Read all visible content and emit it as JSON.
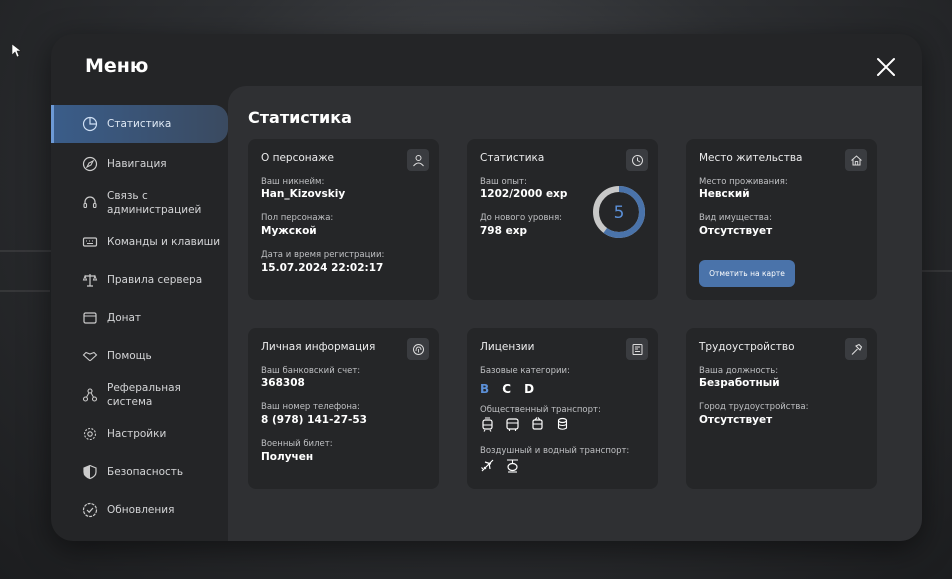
{
  "menu": {
    "title": "Меню"
  },
  "sidebar": {
    "items": [
      {
        "label": "Статистика",
        "icon": "pie-chart-icon"
      },
      {
        "label": "Навигация",
        "icon": "compass-icon"
      },
      {
        "label": "Связь с администрацией",
        "icon": "headset-icon"
      },
      {
        "label": "Команды и клавиши",
        "icon": "keyboard-icon"
      },
      {
        "label": "Правила сервера",
        "icon": "scales-icon"
      },
      {
        "label": "Донат",
        "icon": "wallet-icon"
      },
      {
        "label": "Помощь",
        "icon": "handshake-icon"
      },
      {
        "label": "Реферальная система",
        "icon": "referral-icon"
      },
      {
        "label": "Настройки",
        "icon": "gear-icon"
      },
      {
        "label": "Безопасность",
        "icon": "shield-icon"
      },
      {
        "label": "Обновления",
        "icon": "check-badge-icon"
      }
    ]
  },
  "page": {
    "title": "Статистика"
  },
  "character": {
    "title": "О персонаже",
    "nickname_label": "Ваш никнейм:",
    "nickname": "Han_Kizovskiy",
    "gender_label": "Пол персонажа:",
    "gender": "Мужской",
    "reg_label": "Дата и время регистрации:",
    "reg_date": "15.07.2024 22:02:17"
  },
  "stats": {
    "title": "Статистика",
    "exp_label": "Ваш опыт:",
    "exp": "1202/2000 exp",
    "next_label": "До нового уровня:",
    "next": "798 exp",
    "level": "5",
    "progress": 0.601
  },
  "residence": {
    "title": "Место жительства",
    "place_label": "Место проживания:",
    "place": "Невский",
    "property_label": "Вид имущества:",
    "property": "Отсутствует",
    "button": "Отметить на карте"
  },
  "personal": {
    "title": "Личная информация",
    "bank_label": "Ваш банковский счет:",
    "bank": "368308",
    "phone_label": "Ваш номер телефона:",
    "phone": "8 (978) 141-27-53",
    "military_label": "Военный билет:",
    "military": "Получен"
  },
  "licenses": {
    "title": "Лицензии",
    "base_label": "Базовые категории:",
    "categories": [
      "B",
      "C",
      "D"
    ],
    "public_label": "Общественный транспорт:",
    "air_label": "Воздушный и водный транспорт:"
  },
  "job": {
    "title": "Трудоустройство",
    "position_label": "Ваша должность:",
    "position": "Безработный",
    "city_label": "Город трудоустройства:",
    "city": "Отсутствует"
  },
  "colors": {
    "accent": "#4a73aa",
    "active_letter": "#5b8fd6",
    "ring_track": "#c8c8c8",
    "ring_fill": "#4a73aa"
  }
}
